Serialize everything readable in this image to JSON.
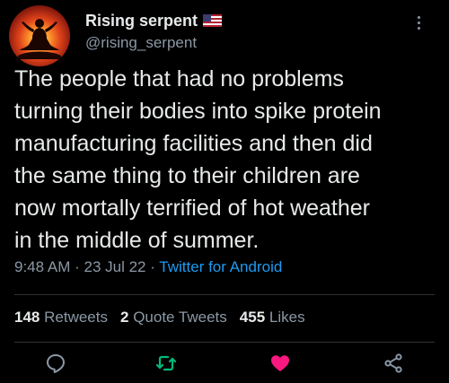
{
  "author": {
    "display_name": "Rising serpent",
    "handle": "@rising_serpent",
    "avatar_icon": "meditating-figure-avatar",
    "flag_icon": "us-flag-icon"
  },
  "tweet": {
    "lines": [
      "The people that had no problems",
      "turning their bodies into spike protein",
      "manufacturing facilities and then did",
      "the same thing to their children are",
      "now mortally terrified of hot weather",
      "in the middle of summer."
    ],
    "time": "9:48 AM",
    "separator": " · ",
    "date": "23 Jul 22",
    "source": "Twitter for Android"
  },
  "stats": {
    "retweets_count": "148",
    "retweets_label": "Retweets",
    "quotes_count": "2",
    "quotes_label": "Quote Tweets",
    "likes_count": "455",
    "likes_label": "Likes"
  },
  "colors": {
    "background": "#000000",
    "text": "#e7e9ea",
    "secondary": "#8b98a5",
    "link": "#1d9bf0",
    "retweet": "#00ba7c",
    "like": "#f91880"
  },
  "icons": [
    "more-options-icon",
    "reply-icon",
    "retweet-icon",
    "like-icon",
    "share-icon"
  ]
}
